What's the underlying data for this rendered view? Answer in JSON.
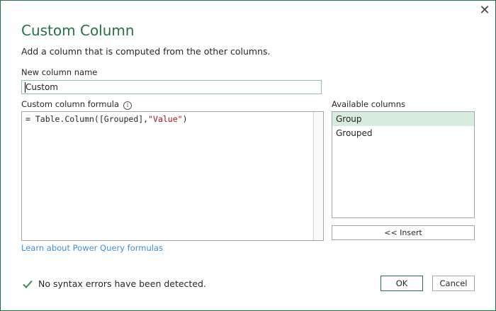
{
  "dialog": {
    "close_glyph": "✕",
    "title": "Custom Column",
    "subtitle": "Add a column that is computed from the other columns.",
    "new_column_label": "New column name",
    "new_column_value": "Custom",
    "formula_label": "Custom column formula",
    "info_glyph": "i",
    "formula_prefix": "= Table.Column([Grouped],",
    "formula_string": "\"Value\"",
    "formula_suffix": ")",
    "available_label": "Available columns",
    "columns": [
      {
        "label": "Group",
        "selected": true
      },
      {
        "label": "Grouped",
        "selected": false
      }
    ],
    "insert_label": "<< Insert",
    "learn_link": "Learn about Power Query formulas",
    "status_text": "No syntax errors have been detected.",
    "ok_label": "OK",
    "cancel_label": "Cancel"
  },
  "colors": {
    "accent": "#217346",
    "selected_bg": "#d6ecdd",
    "link": "#3d8fd6",
    "string_literal": "#a31515",
    "check": "#3a8a5c"
  }
}
